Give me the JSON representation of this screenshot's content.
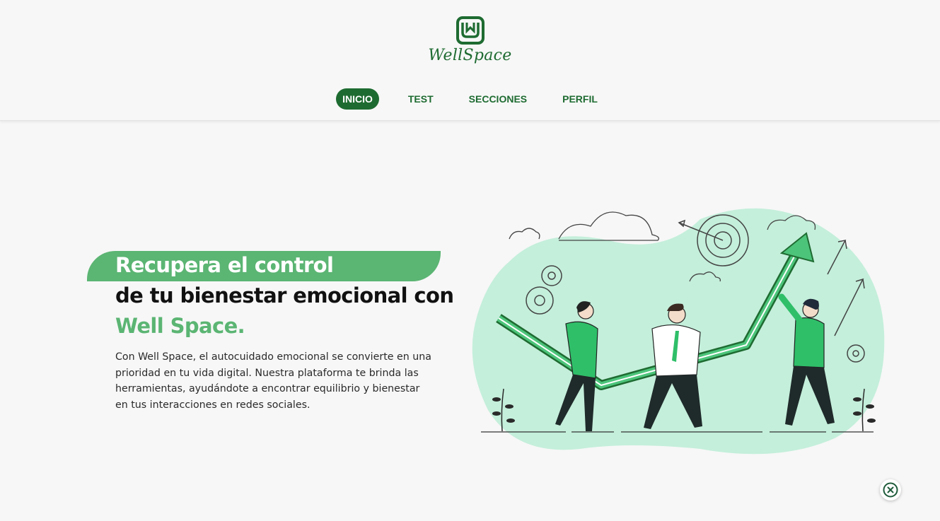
{
  "brand": {
    "name": "WellSpace",
    "logo_icon": "wellspace-logo-icon",
    "color": "#1e6b31",
    "accent": "#5bb573"
  },
  "nav": {
    "items": [
      {
        "label": "INICIO",
        "active": true
      },
      {
        "label": "TEST",
        "active": false
      },
      {
        "label": "SECCIONES",
        "active": false
      },
      {
        "label": "PERFIL",
        "active": false
      }
    ]
  },
  "hero": {
    "line1": "Recupera el control",
    "line2": "de tu bienestar emocional con",
    "line3": "Well Space.",
    "description": "Con Well Space, el autocuidado emocional se convierte en una prioridad en tu vida digital. Nuestra plataforma te brinda las herramientas, ayudándote a encontrar equilibrio y bienestar en tus interacciones en redes sociales."
  },
  "illustration": {
    "icon": "team-growth-arrow-illustration"
  },
  "close_button": {
    "icon": "close-icon"
  }
}
